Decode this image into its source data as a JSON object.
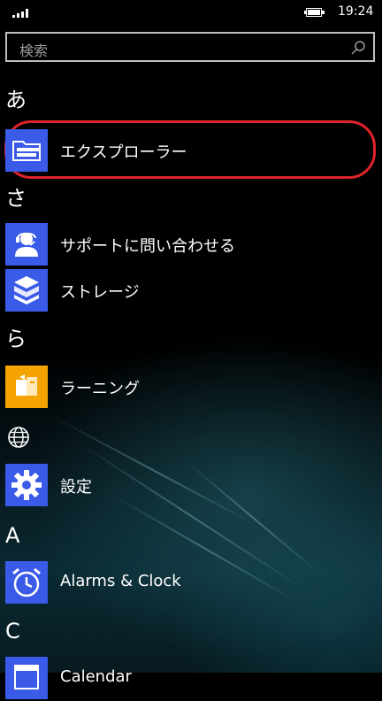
{
  "status_bar": {
    "time": "19:24"
  },
  "search": {
    "placeholder": "検索"
  },
  "groups": [
    {
      "header": "あ"
    },
    {
      "header": "さ"
    },
    {
      "header": "ら"
    },
    {
      "header": "globe"
    },
    {
      "header": "A"
    },
    {
      "header": "C"
    }
  ],
  "apps": [
    {
      "label": "エクスプローラー",
      "icon": "file-explorer-icon",
      "tile_color": "#3a5ae8"
    },
    {
      "label": "サポートに問い合わせる",
      "icon": "contact-support-icon",
      "tile_color": "#3a5ae8"
    },
    {
      "label": "ストレージ",
      "icon": "storage-icon",
      "tile_color": "#3a5ae8"
    },
    {
      "label": "ラーニング",
      "icon": "learning-icon",
      "tile_color": "#f5a300"
    },
    {
      "label": "設定",
      "icon": "gear-icon",
      "tile_color": "#3a5ae8"
    },
    {
      "label": "Alarms & Clock",
      "icon": "alarm-clock-icon",
      "tile_color": "#3a5ae8"
    },
    {
      "label": "Calendar",
      "icon": "calendar-icon",
      "tile_color": "#3a5ae8"
    }
  ],
  "colors": {
    "accent": "#3a5ae8",
    "learning_tile": "#f5a300",
    "highlight_ring": "#e0232b"
  }
}
